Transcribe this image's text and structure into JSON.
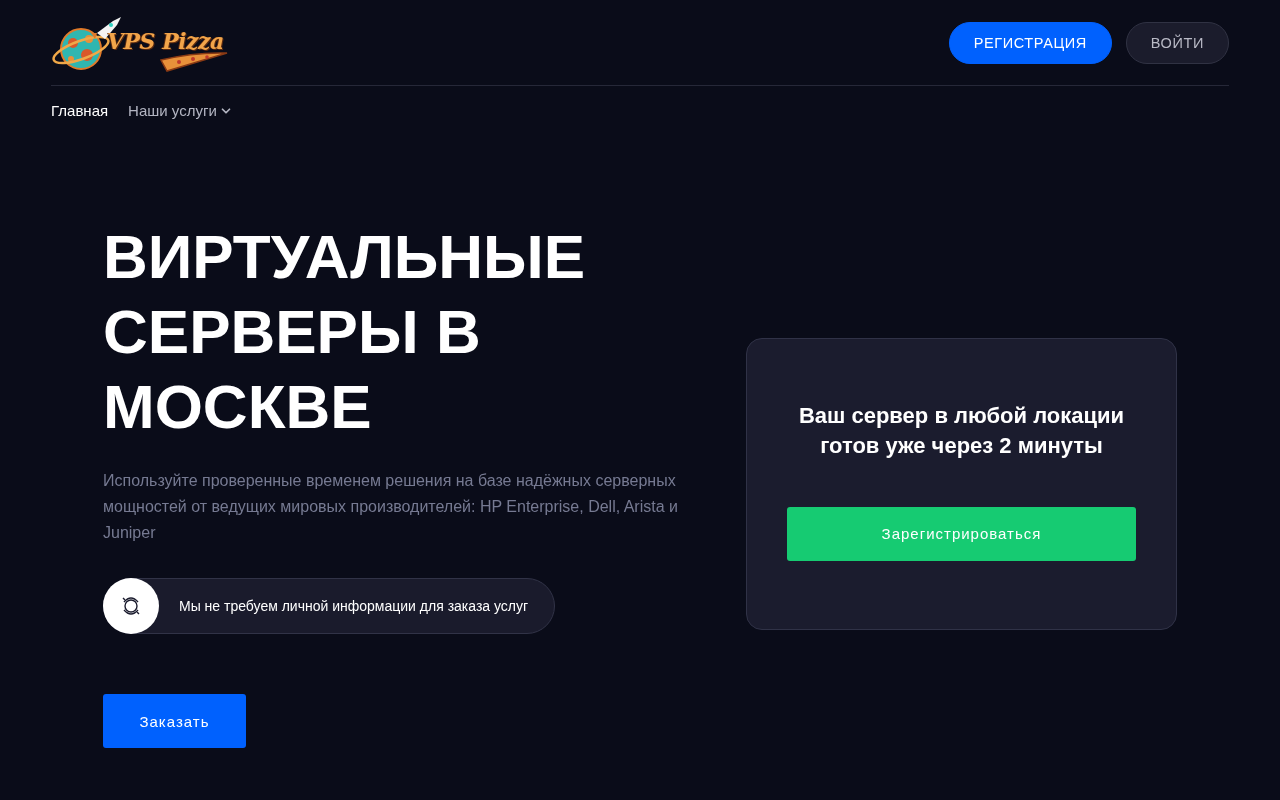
{
  "header": {
    "logo": {
      "text": "VPS Pizza"
    },
    "buttons": [
      {
        "kind": "primary",
        "label": "РЕГИСТРАЦИЯ"
      },
      {
        "kind": "secondary",
        "label": "ВОЙТИ"
      }
    ]
  },
  "nav": [
    {
      "kind": "link",
      "label": "Главная",
      "selected": true
    },
    {
      "kind": "dropdown",
      "label": "Наши услуги",
      "selected": false
    }
  ],
  "hero": {
    "title": "ВИРТУАЛЬНЫЕ СЕРВЕРЫ В МОСКВЕ",
    "description": "Используйте проверенные временем решения на базе надёжных серверных мощностей от ведущих мировых производителей: HP Enterprise, Dell, Arista и Juniper",
    "note": "Мы не требуем личной информации для заказа услуг",
    "order_button": "Заказать"
  },
  "card": {
    "title": "Ваш сервер в любой локации готов уже через 2 минуты",
    "button": "Зарегистрироваться"
  }
}
